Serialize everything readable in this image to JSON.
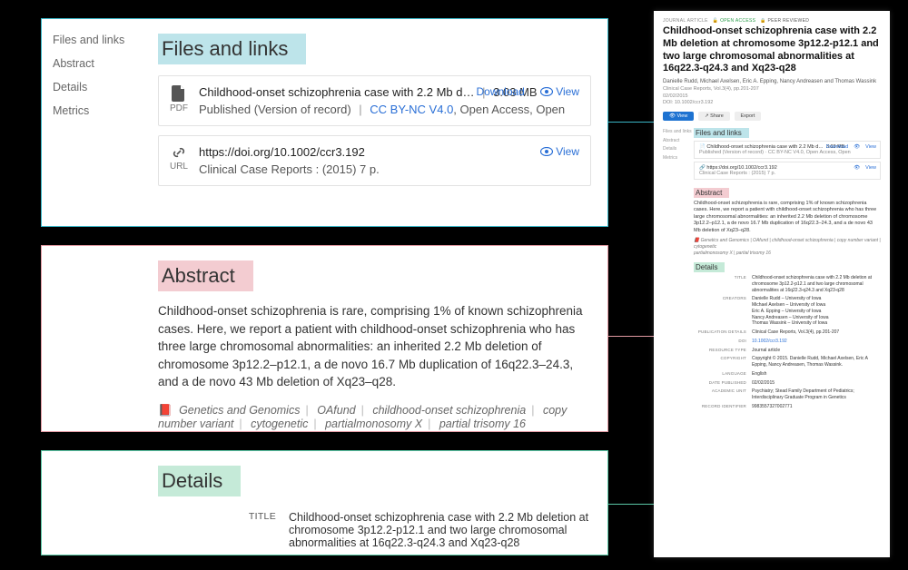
{
  "nav": {
    "items": [
      "Files and links",
      "Abstract",
      "Details",
      "Metrics"
    ]
  },
  "sections": {
    "files_heading": "Files and links",
    "abstract_heading": "Abstract",
    "details_heading": "Details"
  },
  "files": {
    "pdf": {
      "icon_label": "PDF",
      "title": "Childhood-onset schizophrenia case with 2.2 Mb d…",
      "size": "3.03 MB",
      "download": "Download",
      "view": "View",
      "sub_version": "Published (Version of record)",
      "license": "CC BY-NC V4.0",
      "access": ", Open Access, Open"
    },
    "url": {
      "icon_label": "URL",
      "title": "https://doi.org/10.1002/ccr3.192",
      "view": "View",
      "sub": "Clinical Case Reports : (2015) 7 p."
    }
  },
  "abstract": {
    "text": "Childhood-onset schizophrenia is rare, comprising 1% of known schizophrenia cases. Here, we report a patient with childhood-onset schizophrenia who has three large chromosomal abnormalities: an inherited 2.2 Mb deletion of chromosome 3p12.2–p12.1, a de novo 16.7 Mb duplication of 16q22.3–24.3, and a de novo 43 Mb deletion of Xq23–q28.",
    "tags": [
      "Genetics and Genomics",
      "OAfund",
      "childhood-onset schizophrenia",
      "copy number variant",
      "cytogenetic",
      "partialmonosomy X",
      "partial trisomy 16"
    ]
  },
  "details_left": {
    "title_label": "TITLE",
    "title_value": "Childhood-onset schizophrenia case with 2.2 Mb deletion at chromosome 3p12.2-p12.1 and two large chromosomal abnormalities at 16q22.3-q24.3 and Xq23-q28"
  },
  "fullpage": {
    "meta": {
      "type": "JOURNAL ARTICLE",
      "open_access": "OPEN ACCESS",
      "peer": "PEER REVIEWED"
    },
    "title": "Childhood-onset schizophrenia case with 2.2 Mb deletion at chromosome 3p12.2-p12.1 and two large chromosomal abnormalities at 16q22.3-q24.3 and Xq23-q28",
    "authors": "Danielle Rudd, Michael Axelsen, Eric A. Epping, Nancy Andreasen and Thomas Wassink",
    "citation": "Clinical Case Reports, Vol.3(4), pp.201-207",
    "date": "02/02/2015",
    "doi_line": "DOI: 10.1002/ccr3.192",
    "buttons": {
      "view": "View",
      "share": "Share",
      "export": "Export"
    },
    "nav": [
      "Files and links",
      "Abstract",
      "Details",
      "Metrics"
    ],
    "files_heading": "Files and links",
    "pdf": {
      "title": "Childhood-onset schizophrenia case with 2.2 Mb d…",
      "size": "3.03 MB",
      "download": "Download",
      "view": "View",
      "sub": "Published (Version of record)  ·  CC BY-NC V4.0, Open Access, Open"
    },
    "url": {
      "title": "https://doi.org/10.1002/ccr3.192",
      "view": "View",
      "sub": "Clinical Case Reports : (2015) 7 p."
    },
    "abstract_heading": "Abstract",
    "abstract_text": "Childhood-onset schizophrenia is rare, comprising 1% of known schizophrenia cases. Here, we report a patient with childhood-onset schizophrenia who has three large chromosomal abnormalities: an inherited 2.2 Mb deletion of chromosome 3p12.2–p12.1, a de novo 16.7 Mb duplication of 16q22.3–24.3, and a de novo 43 Mb deletion of Xq23–q28.",
    "tags_line1": "Genetics and Genomics  |  OAfund  |  childhood-onset schizophrenia  |  copy number variant  |  cytogenetic",
    "tags_line2": "partialmonosomy X  |  partial trisomy 16",
    "details_heading": "Details",
    "details": [
      {
        "label": "TITLE",
        "value": "Childhood-onset schizophrenia case with 2.2 Mb deletion at chromosome 3p12.2-p12.1 and two large chromosomal abnormalities at 16q22.3-q24.3 and Xq23-q28"
      },
      {
        "label": "CREATORS",
        "value": "Danielle Rudd – University of Iowa\nMichael Axelsen – University of Iowa\nEric A. Epping – University of Iowa\nNancy Andreasen – University of Iowa\nThomas Wassink – University of Iowa"
      },
      {
        "label": "PUBLICATION DETAILS",
        "value": "Clinical Case Reports, Vol.3(4), pp.201-207"
      },
      {
        "label": "DOI",
        "value": "10.1002/ccr3.192",
        "blue": true
      },
      {
        "label": "RESOURCE TYPE",
        "value": "Journal article"
      },
      {
        "label": "COPYRIGHT",
        "value": "Copyright © 2015. Danielle Rudd, Michael Axelsen, Eric A Epping, Nancy Andreasen, Thomas Wassink."
      },
      {
        "label": "LANGUAGE",
        "value": "English"
      },
      {
        "label": "DATE PUBLISHED",
        "value": "02/02/2015"
      },
      {
        "label": "ACADEMIC UNIT",
        "value": "Psychiatry; Stead Family Department of Pediatrics; Interdisciplinary Graduate Program in Genetics"
      },
      {
        "label": "RECORD IDENTIFIER",
        "value": "9983557327002771"
      }
    ]
  }
}
